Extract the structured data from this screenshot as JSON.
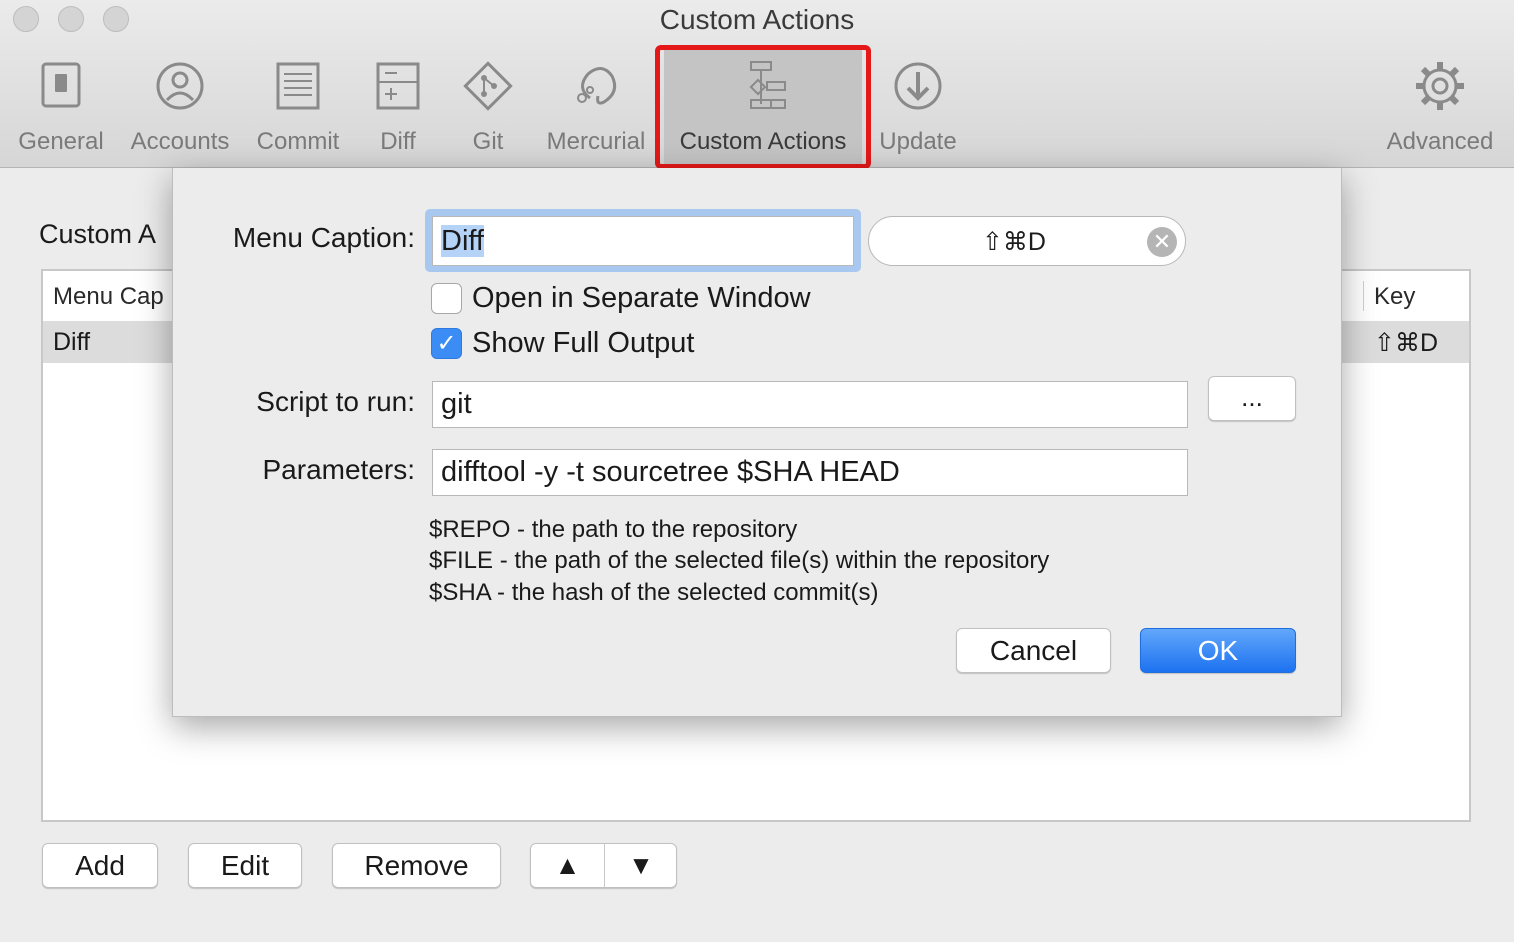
{
  "window": {
    "title": "Custom Actions"
  },
  "toolbar": {
    "items": [
      {
        "label": "General",
        "icon": "general-icon"
      },
      {
        "label": "Accounts",
        "icon": "accounts-icon"
      },
      {
        "label": "Commit",
        "icon": "commit-icon"
      },
      {
        "label": "Diff",
        "icon": "diff-icon"
      },
      {
        "label": "Git",
        "icon": "git-icon"
      },
      {
        "label": "Mercurial",
        "icon": "mercurial-icon"
      },
      {
        "label": "Custom Actions",
        "icon": "custom-actions-icon",
        "selected": true
      },
      {
        "label": "Update",
        "icon": "update-icon"
      },
      {
        "label": "Advanced",
        "icon": "gear-icon"
      }
    ]
  },
  "main": {
    "section_title": "Custom A",
    "table": {
      "columns": [
        "Menu Cap",
        "Key"
      ],
      "rows": [
        {
          "caption": "Diff",
          "key": "⇧⌘D"
        }
      ]
    },
    "buttons": {
      "add": "Add",
      "edit": "Edit",
      "remove": "Remove",
      "up": "▲",
      "down": "▼"
    }
  },
  "dialog": {
    "menu_caption_label": "Menu Caption:",
    "menu_caption_value": "Diff",
    "shortcut_value": "⇧⌘D",
    "open_separate_label": "Open in Separate Window",
    "open_separate_checked": false,
    "show_full_output_label": "Show Full Output",
    "show_full_output_checked": true,
    "script_label": "Script to run:",
    "script_value": "git",
    "browse_label": "...",
    "parameters_label": "Parameters:",
    "parameters_value": "difftool -y -t sourcetree $SHA HEAD",
    "help_lines": [
      "$REPO - the path to the repository",
      "$FILE - the path of the selected file(s) within the repository",
      "$SHA - the hash of the selected commit(s)"
    ],
    "cancel_label": "Cancel",
    "ok_label": "OK"
  },
  "colors": {
    "accent": "#1d72f0",
    "highlight_border": "#e41818",
    "checkbox_blue": "#3b8cf5"
  }
}
